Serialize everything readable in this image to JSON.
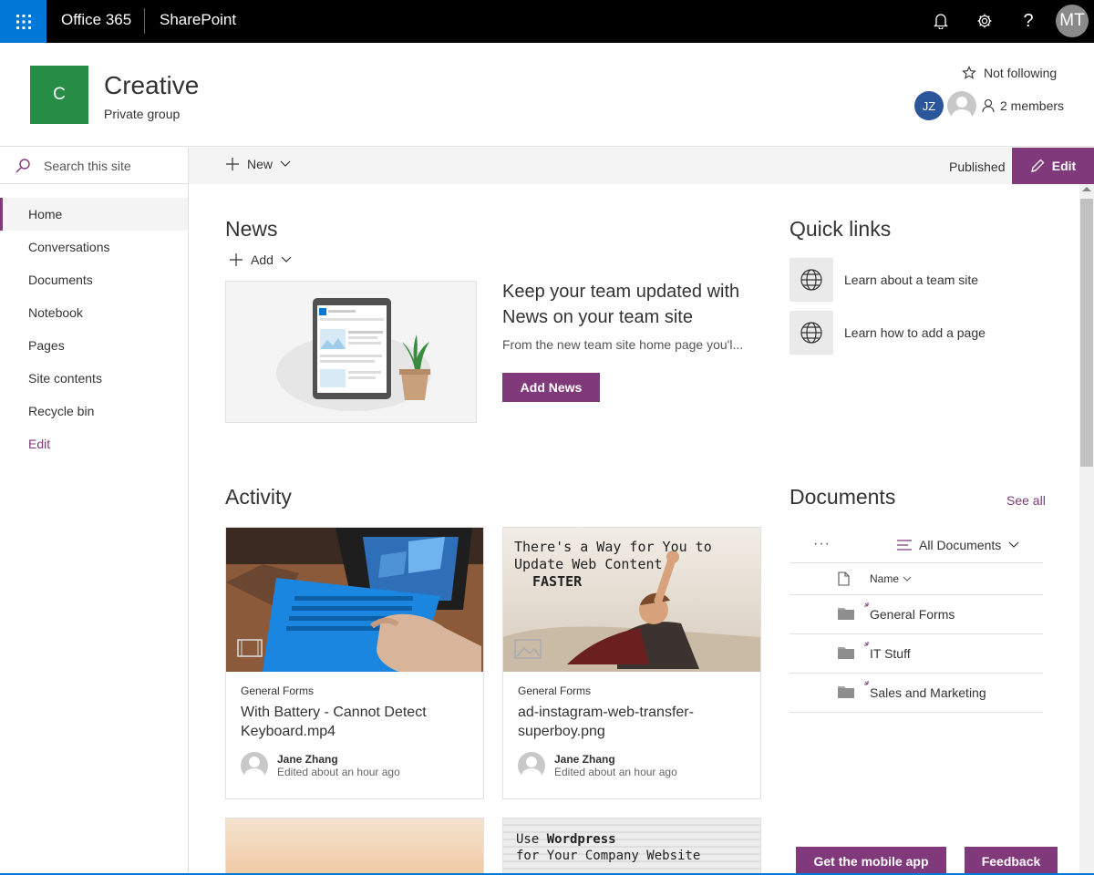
{
  "suite_bar": {
    "suite": "Office 365",
    "app": "SharePoint",
    "user_initials": "MT"
  },
  "site": {
    "logo_letter": "C",
    "title": "Creative",
    "subtitle": "Private group",
    "follow_label": "Not following",
    "member_initials": "JZ",
    "members_label": "2 members"
  },
  "search": {
    "placeholder": "Search this site"
  },
  "nav": {
    "items": [
      "Home",
      "Conversations",
      "Documents",
      "Notebook",
      "Pages",
      "Site contents",
      "Recycle bin",
      "Edit"
    ],
    "active": "Home"
  },
  "command_bar": {
    "new_label": "New",
    "status": "Published",
    "edit_label": "Edit"
  },
  "news": {
    "title": "News",
    "add_label": "Add",
    "headline": "Keep your team updated with News on your team site",
    "description": "From the new team site home page you'l...",
    "button": "Add News"
  },
  "quick_links": {
    "title": "Quick links",
    "items": [
      "Learn about a team site",
      "Learn how to add a page"
    ]
  },
  "activity": {
    "title": "Activity",
    "cards": [
      {
        "library": "General Forms",
        "title": "With Battery - Cannot Detect Keyboard.mp4",
        "author": "Jane Zhang",
        "time": "Edited about an hour ago"
      },
      {
        "library": "General Forms",
        "title": "ad-instagram-web-transfer-superboy.png",
        "author": "Jane Zhang",
        "time": "Edited about an hour ago",
        "image_text_1": "There's a Way for You to",
        "image_text_2": "Update Web Content",
        "image_text_3": "FASTER"
      }
    ],
    "partial_card_text_1": "Use ",
    "partial_card_text_bold": "Wordpress",
    "partial_card_text_2": "for Your Company Website"
  },
  "documents": {
    "title": "Documents",
    "see_all": "See all",
    "more": "···",
    "view": "All Documents",
    "name_header": "Name",
    "rows": [
      "General Forms",
      "IT Stuff",
      "Sales and Marketing"
    ]
  },
  "footer": {
    "mobile_app": "Get the mobile app",
    "feedback": "Feedback"
  },
  "colors": {
    "accent": "#80397b",
    "brand_blue": "#0078d7",
    "site_logo": "#268c46"
  }
}
